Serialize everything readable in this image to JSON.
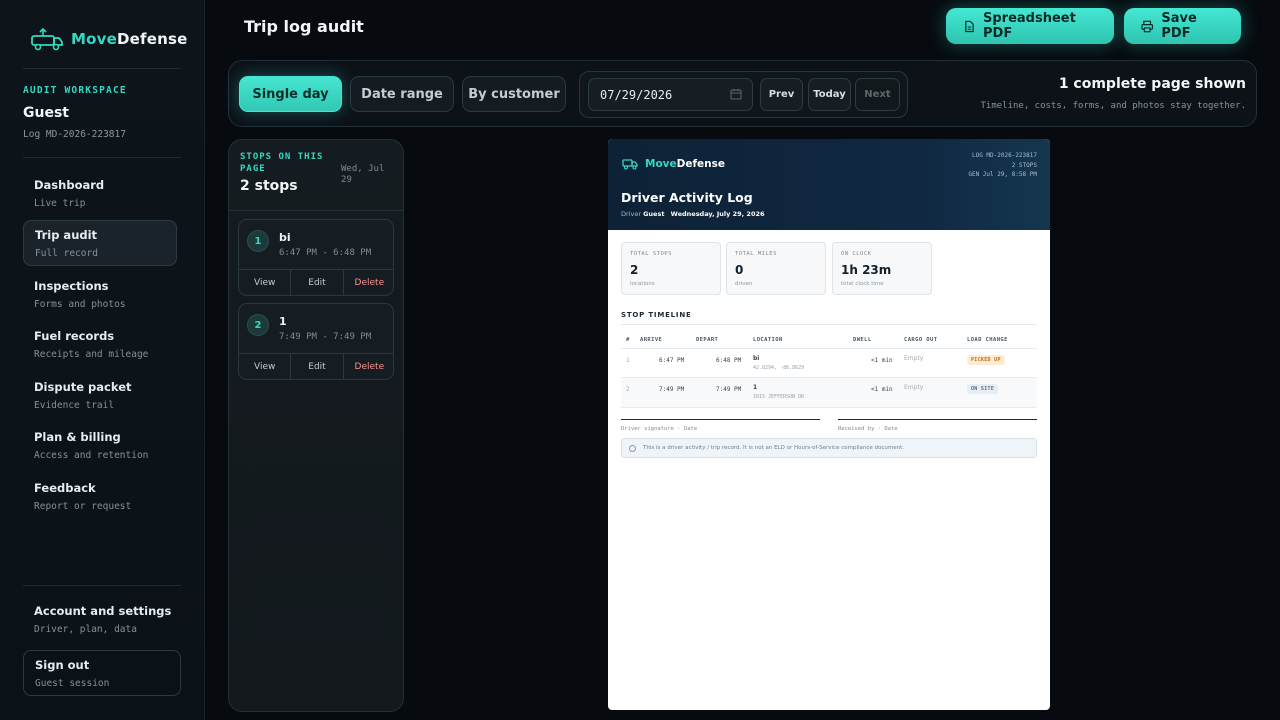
{
  "brand": {
    "name_part1": "Move",
    "name_part2": "Defense"
  },
  "sidebar": {
    "workspace_label": "AUDIT WORKSPACE",
    "user": "Guest",
    "log_id": "Log MD-2026-223817",
    "items": [
      {
        "title": "Dashboard",
        "sub": "Live trip"
      },
      {
        "title": "Trip audit",
        "sub": "Full record"
      },
      {
        "title": "Inspections",
        "sub": "Forms and photos"
      },
      {
        "title": "Fuel records",
        "sub": "Receipts and mileage"
      },
      {
        "title": "Dispute packet",
        "sub": "Evidence trail"
      },
      {
        "title": "Plan & billing",
        "sub": "Access and retention"
      },
      {
        "title": "Feedback",
        "sub": "Report or request"
      }
    ],
    "account": {
      "title": "Account and settings",
      "sub": "Driver, plan, data"
    },
    "signout": {
      "title": "Sign out",
      "sub": "Guest session"
    }
  },
  "header": {
    "title": "Trip log audit",
    "spreadsheet_btn": "Spreadsheet PDF",
    "save_btn": "Save PDF"
  },
  "toolbar": {
    "modes": [
      "Single day",
      "Date range",
      "By customer"
    ],
    "date_value": "07/29/2026",
    "prev": "Prev",
    "today": "Today",
    "next": "Next",
    "pages_title": "1 complete page shown",
    "pages_sub": "Timeline, costs, forms, and photos stay together."
  },
  "stops_panel": {
    "label": "STOPS ON THIS PAGE",
    "date": "Wed, Jul 29",
    "count": "2 stops",
    "stops": [
      {
        "num": "1",
        "name": "bi",
        "time": "6:47 PM - 6:48 PM"
      },
      {
        "num": "2",
        "name": "1",
        "time": "7:49 PM - 7:49 PM"
      }
    ],
    "actions": {
      "view": "View",
      "edit": "Edit",
      "delete": "Delete"
    }
  },
  "document": {
    "brand_part1": "Move",
    "brand_part2": "Defense",
    "meta": [
      "LOG MD-2026-223817",
      "2 STOPS",
      "GEN Jul 29, 8:58 PM"
    ],
    "title": "Driver Activity Log",
    "driver_label": "Driver",
    "driver": "Guest",
    "date": "Wednesday, July 29, 2026",
    "stats": [
      {
        "label": "TOTAL STOPS",
        "value": "2",
        "sub": "locations"
      },
      {
        "label": "TOTAL MILES",
        "value": "0",
        "sub": "driven"
      },
      {
        "label": "ON CLOCK",
        "value": "1h 23m",
        "sub": "total clock time"
      }
    ],
    "section_title": "STOP TIMELINE",
    "columns": [
      "#",
      "ARRIVE",
      "DEPART",
      "LOCATION",
      "DWELL",
      "CARGO OUT",
      "LOAD CHANGE"
    ],
    "rows": [
      {
        "num": "1",
        "arrive": "6:47 PM",
        "depart": "6:48 PM",
        "location": "bi",
        "location_sub": "42.8294, -86.8629",
        "dwell": "<1 min",
        "cargo": "Empty",
        "load": "PICKED UP"
      },
      {
        "num": "2",
        "arrive": "7:49 PM",
        "depart": "7:49 PM",
        "location": "1",
        "location_sub": "1015 JEFFERSON DR",
        "dwell": "<1 min",
        "cargo": "Empty",
        "load": "ON SITE"
      }
    ],
    "sig_driver": "Driver signature  ·  Date",
    "sig_received": "Received by  ·  Date",
    "note": "This is a driver activity / trip record. It is not an ELD or Hours-of-Service compliance document."
  },
  "colors": {
    "accent": "#35d8c3",
    "bg": "#070b10",
    "danger": "#ff8f8f"
  }
}
